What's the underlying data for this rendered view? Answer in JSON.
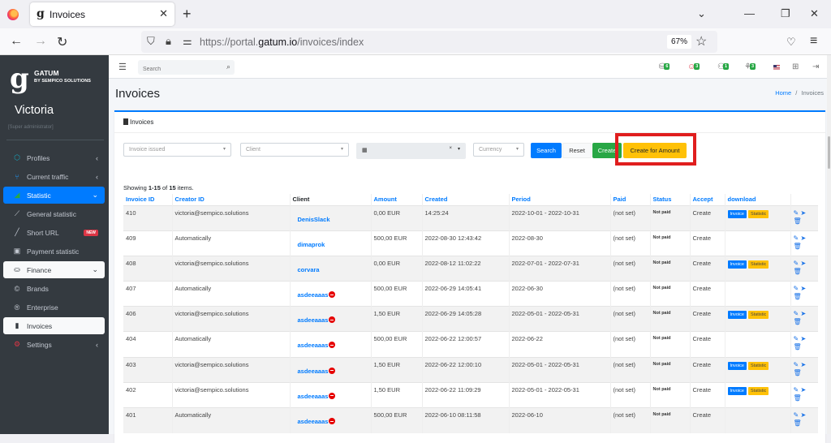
{
  "browser": {
    "tab_title": "Invoices",
    "url_prefix": "https://portal.",
    "url_domain": "gatum.io",
    "url_path": "/invoices/index",
    "zoom_level": "67%"
  },
  "sidebar": {
    "brand_name": "GATUM",
    "brand_sub": "BY SEMPICO SOLUTIONS",
    "user_name": "Victoria",
    "user_role": "[Super administrator]",
    "items": [
      {
        "label": "Profiles",
        "icon": "profiles-icon"
      },
      {
        "label": "Current traffic",
        "icon": "traffic-icon"
      },
      {
        "label": "Statistic",
        "icon": "chart-icon"
      },
      {
        "label": "General statistic",
        "icon": "line-chart-icon"
      },
      {
        "label": "Short URL",
        "icon": "link-icon",
        "badge": "NEW"
      },
      {
        "label": "Payment statistic",
        "icon": "payment-icon"
      },
      {
        "label": "Finance",
        "icon": "finance-icon"
      },
      {
        "label": "Brands",
        "icon": "copyright-icon"
      },
      {
        "label": "Enterprise",
        "icon": "registered-icon"
      },
      {
        "label": "Invoices",
        "icon": "file-invoice-icon"
      },
      {
        "label": "Settings",
        "icon": "gears-icon"
      }
    ]
  },
  "topbar": {
    "search_placeholder": "Search",
    "counters": [
      "6",
      "3",
      "1",
      "3"
    ]
  },
  "page": {
    "title": "Invoices",
    "breadcrumb_home": "Home",
    "breadcrumb_sep": "/",
    "breadcrumb_current": "Invoices",
    "card_title": "Invoices"
  },
  "filters": {
    "invoice_issued_placeholder": "Invoice issued",
    "client_placeholder": "Client",
    "date_clear": "×",
    "currency_placeholder": "Currency",
    "search_label": "Search",
    "reset_label": "Reset",
    "create_label": "Create",
    "create_for_amount_label": "Create for Amount"
  },
  "table": {
    "summary_prefix": "Showing ",
    "summary_range": "1-15",
    "summary_mid": " of ",
    "summary_total": "15",
    "summary_suffix": " items.",
    "headers": [
      "Invoice ID",
      "Creator ID",
      "Client",
      "Amount",
      "Created",
      "Period",
      "Paid",
      "Status",
      "Accept",
      "download"
    ],
    "download_invoice_label": "Invoice",
    "download_statistic_label": "Statistic",
    "rows": [
      {
        "id": "410",
        "creator": "victoria@sempico.solutions",
        "client": "DenisSlack",
        "blocked": false,
        "amount": "0,00 EUR",
        "created": "14:25:24",
        "period": "2022-10-01 - 2022-10-31",
        "paid": "(not set)",
        "status": "Not paid",
        "accept": "Create",
        "downloads": true
      },
      {
        "id": "409",
        "creator": "Automatically",
        "client": "dimaprok",
        "blocked": false,
        "amount": "500,00 EUR",
        "created": "2022-08-30 12:43:42",
        "period": "2022-08-30",
        "paid": "(not set)",
        "status": "Not paid",
        "accept": "Create",
        "downloads": false
      },
      {
        "id": "408",
        "creator": "victoria@sempico.solutions",
        "client": "corvara",
        "blocked": false,
        "amount": "0,00 EUR",
        "created": "2022-08-12 11:02:22",
        "period": "2022-07-01 - 2022-07-31",
        "paid": "(not set)",
        "status": "Not paid",
        "accept": "Create",
        "downloads": true
      },
      {
        "id": "407",
        "creator": "Automatically",
        "client": "asdeeaaas",
        "blocked": true,
        "amount": "500,00 EUR",
        "created": "2022-06-29 14:05:41",
        "period": "2022-06-30",
        "paid": "(not set)",
        "status": "Not paid",
        "accept": "Create",
        "downloads": false
      },
      {
        "id": "406",
        "creator": "victoria@sempico.solutions",
        "client": "asdeeaaas",
        "blocked": true,
        "amount": "1,50 EUR",
        "created": "2022-06-29 14:05:28",
        "period": "2022-05-01 - 2022-05-31",
        "paid": "(not set)",
        "status": "Not paid",
        "accept": "Create",
        "downloads": true
      },
      {
        "id": "404",
        "creator": "Automatically",
        "client": "asdeeaaas",
        "blocked": true,
        "amount": "500,00 EUR",
        "created": "2022-06-22 12:00:57",
        "period": "2022-06-22",
        "paid": "(not set)",
        "status": "Not paid",
        "accept": "Create",
        "downloads": false
      },
      {
        "id": "403",
        "creator": "victoria@sempico.solutions",
        "client": "asdeeaaas",
        "blocked": true,
        "amount": "1,50 EUR",
        "created": "2022-06-22 12:00:10",
        "period": "2022-05-01 - 2022-05-31",
        "paid": "(not set)",
        "status": "Not paid",
        "accept": "Create",
        "downloads": true
      },
      {
        "id": "402",
        "creator": "victoria@sempico.solutions",
        "client": "asdeeaaas",
        "blocked": true,
        "amount": "1,50 EUR",
        "created": "2022-06-22 11:09:29",
        "period": "2022-05-01 - 2022-05-31",
        "paid": "(not set)",
        "status": "Not paid",
        "accept": "Create",
        "downloads": true
      },
      {
        "id": "401",
        "creator": "Automatically",
        "client": "asdeeaaas",
        "blocked": true,
        "amount": "500,00 EUR",
        "created": "2022-06-10 08:11:58",
        "period": "2022-06-10",
        "paid": "(not set)",
        "status": "Not paid",
        "accept": "Create",
        "downloads": false
      }
    ]
  },
  "colors": {
    "primary": "#007bff",
    "success": "#28a745",
    "warning": "#ffc107",
    "danger": "#dc3545",
    "sidebar_bg": "#343a40",
    "highlight": "#e01e1e"
  }
}
